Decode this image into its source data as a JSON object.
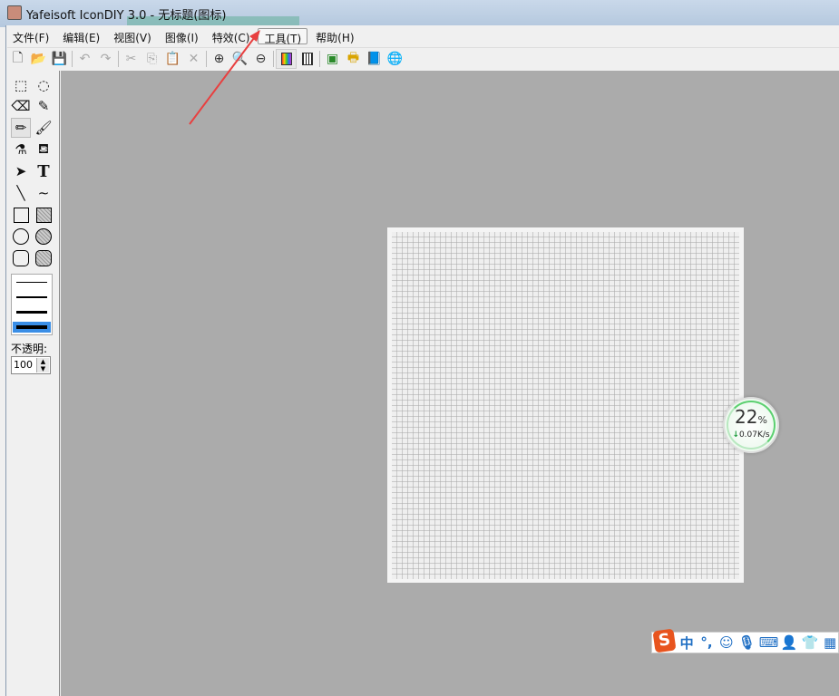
{
  "window": {
    "title": "Yafeisoft IconDIY 3.0 - 无标题(图标)"
  },
  "menu": [
    "文件(F)",
    "编辑(E)",
    "视图(V)",
    "图像(I)",
    "特效(C)",
    "工具(T)",
    "帮助(H)"
  ],
  "toolbox": {
    "opacity_label": "不透明:",
    "opacity_value": "100"
  },
  "net_monitor": {
    "percent": "22",
    "percent_sign": "%",
    "speed": "0.07K/s",
    "speed_arrow": "↓"
  },
  "ime": {
    "logo": "S",
    "mode": "中",
    "punct": "°,"
  },
  "colors": {
    "accent_arrow": "#e84040",
    "selected_line": "#3a8ee6",
    "workspace": "#ababab"
  }
}
